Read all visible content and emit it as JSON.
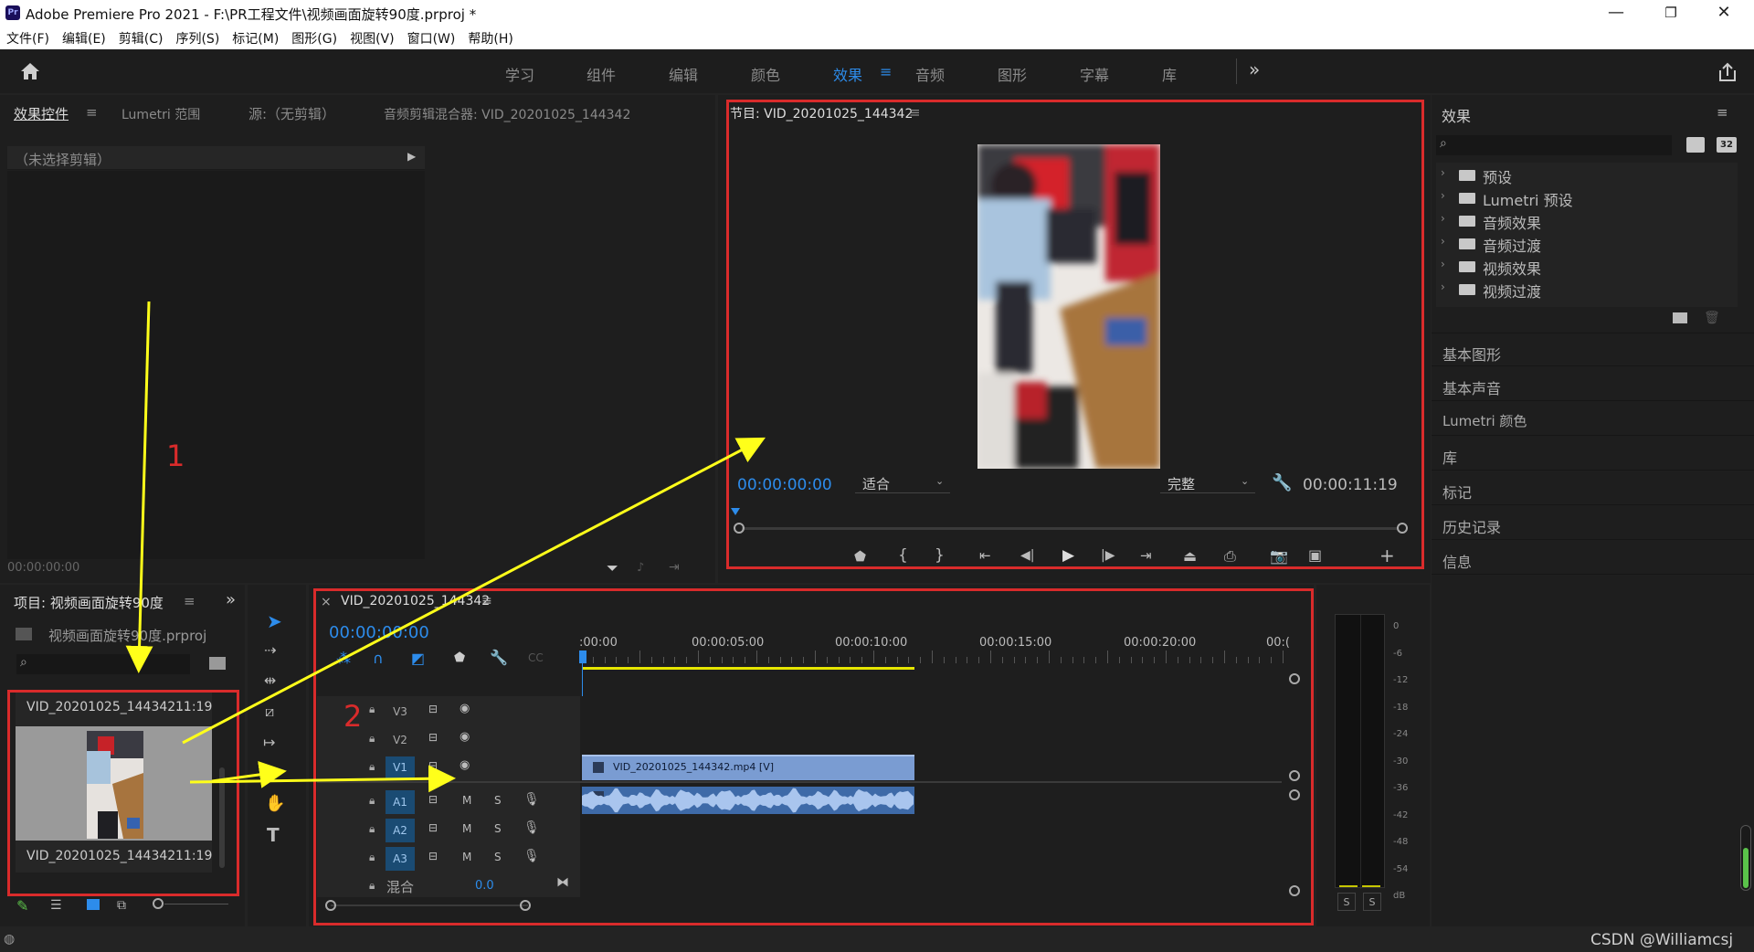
{
  "window": {
    "title": "Adobe Premiere Pro 2021 - F:\\PR工程文件\\视频画面旋转90度.prproj *",
    "logo_text": "Pr",
    "minimize": "—",
    "maximize": "❐",
    "close": "✕"
  },
  "menu": [
    "文件(F)",
    "编辑(E)",
    "剪辑(C)",
    "序列(S)",
    "标记(M)",
    "图形(G)",
    "视图(V)",
    "窗口(W)",
    "帮助(H)"
  ],
  "workspaces": {
    "items": [
      "学习",
      "组件",
      "编辑",
      "颜色",
      "效果",
      "音频",
      "图形",
      "字幕",
      "库"
    ],
    "active": "效果",
    "more": "»"
  },
  "source_panel": {
    "tabs": [
      "效果控件",
      "Lumetri 范围",
      "源:（无剪辑）",
      "音频剪辑混合器: VID_20201025_144342"
    ],
    "menu_glyph": "≡",
    "no_clip": "（未选择剪辑）",
    "timecode": "00:00:00:00"
  },
  "program_monitor": {
    "title": "节目: VID_20201025_144342",
    "menu_glyph": "≡",
    "timecode_current": "00:00:00:00",
    "fit": "适合",
    "quality": "完整",
    "timecode_total": "00:00:11:19"
  },
  "project_panel": {
    "title": "项目: 视频画面旋转90度",
    "menu_glyph": "≡",
    "more": "»",
    "file": "视频画面旋转90度.prproj",
    "clip_top_label": "VID_20201025_144342...",
    "clip_top_duration": "11:19",
    "clip_name": "VID_20201025_144342",
    "clip_duration": "11:19"
  },
  "timeline": {
    "close": "×",
    "sequence": "VID_20201025_144342",
    "menu_glyph": "≡",
    "timecode": "00:00:00:00",
    "ruler": ":00:00",
    "ruler_labels": [
      ":00:00",
      "00:00:05:00",
      "00:00:10:00",
      "00:00:15:00",
      "00:00:20:00",
      "00:("
    ],
    "video_tracks": [
      "V3",
      "V2",
      "V1"
    ],
    "audio_tracks": [
      "A1",
      "A2",
      "A3"
    ],
    "mute": "M",
    "solo": "S",
    "mix_label": "混合",
    "mix_value": "0.0",
    "video_clip_label": "VID_20201025_144342.mp4 [V]"
  },
  "meter": {
    "scale": [
      "0",
      "-6",
      "-12",
      "-18",
      "-24",
      "-30",
      "-36",
      "-42",
      "-48",
      "-54",
      "dB"
    ],
    "solo_left": "S",
    "solo_right": "S"
  },
  "effects_panel": {
    "title": "效果",
    "menu_glyph": "≡",
    "folders": [
      "预设",
      "Lumetri 预设",
      "音频效果",
      "音频过渡",
      "视频效果",
      "视频过渡"
    ],
    "badge": "32",
    "sections": [
      "基本图形",
      "基本声音",
      "Lumetri 颜色",
      "库",
      "标记",
      "历史记录",
      "信息"
    ]
  },
  "annotations": {
    "label1": "1",
    "label2": "2",
    "arrow_color": "#ffff1a",
    "box_color": "#d92b2b"
  },
  "watermark": "CSDN @Williamcsj",
  "colors": {
    "accent": "#2d8ceb",
    "clip_video": "#7a9cd2",
    "clip_audio": "#3e6aa8"
  }
}
